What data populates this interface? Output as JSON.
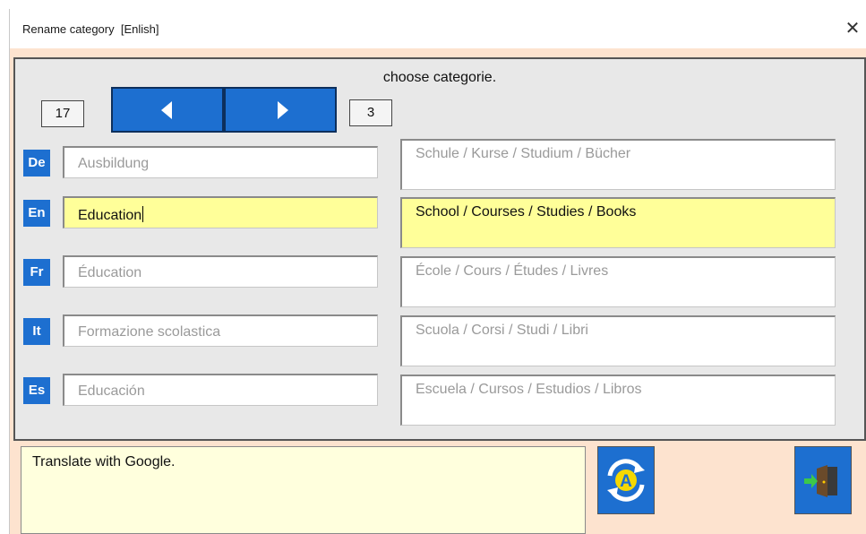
{
  "window": {
    "title": "Rename category  [Enlish]",
    "close_glyph": "✕"
  },
  "panel": {
    "heading": "choose categorie.",
    "left_counter": "17",
    "right_counter": "3"
  },
  "rows": [
    {
      "lang": "De",
      "name": "Ausbildung",
      "description": "Schule / Kurse / Studium / Bücher"
    },
    {
      "lang": "En",
      "name": "Education",
      "description": "School / Courses / Studies / Books"
    },
    {
      "lang": "Fr",
      "name": "Éducation",
      "description": "École / Cours / Études / Livres"
    },
    {
      "lang": "It",
      "name": "Formazione scolastica",
      "description": "Scuola / Corsi / Studi / Libri"
    },
    {
      "lang": "Es",
      "name": "Educación",
      "description": "Escuela / Cursos / Estudios / Libros"
    }
  ],
  "status": {
    "text": "Translate with Google."
  },
  "icons": {
    "translate": "google-translate-icon",
    "exit": "exit-door-icon"
  },
  "colors": {
    "accent_blue": "#1d6fd0",
    "active_field": "#ffff99",
    "window_bg": "#fde3cf",
    "panel_bg": "#e8e8e8"
  }
}
